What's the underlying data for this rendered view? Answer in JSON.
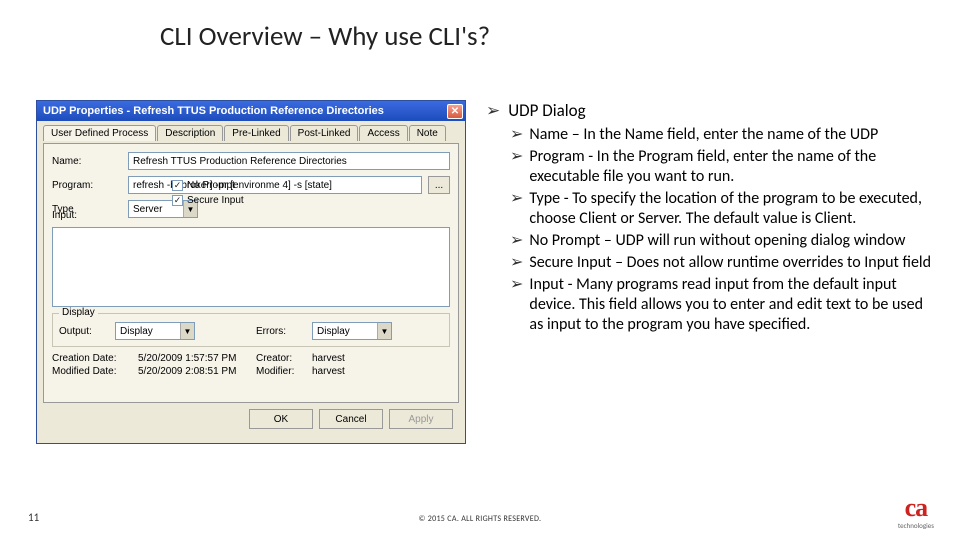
{
  "title": "CLI Overview – Why use CLI's?",
  "dialog": {
    "titlebar": "UDP Properties - Refresh TTUS Production Reference Directories",
    "tabs": [
      "User Defined Process",
      "Description",
      "Pre-Linked",
      "Post-Linked",
      "Access",
      "Note"
    ],
    "fields": {
      "name_label": "Name:",
      "name_value": "Refresh TTUS Production Reference Directories",
      "program_label": "Program:",
      "program_value": "refresh -b [broker] -pr [environme 4] -s [state]",
      "ellipsis": "...",
      "type_label": "Type",
      "type_value": "Server",
      "chk_noprompt": "No Prompt",
      "chk_secure": "Secure Input",
      "input_label": "Input:",
      "display_group": "Display",
      "output_label": "Output:",
      "output_value": "Display",
      "errors_label": "Errors:",
      "errors_value": "Display",
      "creation_date_label": "Creation Date:",
      "creation_date_value": "5/20/2009 1:57:57 PM",
      "creator_label": "Creator:",
      "creator_value": "harvest",
      "modified_date_label": "Modified Date:",
      "modified_date_value": "5/20/2009 2:08:51 PM",
      "modifier_label": "Modifier:",
      "modifier_value": "harvest"
    },
    "buttons": {
      "ok": "OK",
      "cancel": "Cancel",
      "apply": "Apply"
    }
  },
  "bullets": {
    "h1": "UDP Dialog",
    "items": [
      "Name – In the Name field, enter the name of the UDP",
      "Program - In the Program field, enter the name of the executable file you want to run.",
      "Type - To specify the location of the program to be executed, choose Client or Server. The default value is Client.",
      "No Prompt – UDP will run without opening dialog window",
      "Secure Input – Does not allow runtime overrides to Input field",
      "Input - Many programs read input from the default input device. This field allows you to enter and edit text to be used as input to the program you have specified."
    ]
  },
  "footer": {
    "page": "11",
    "copyright": "© 2015 CA. ALL RIGHTS RESERVED.",
    "logo_main": "ca",
    "logo_sub": "technologies"
  }
}
